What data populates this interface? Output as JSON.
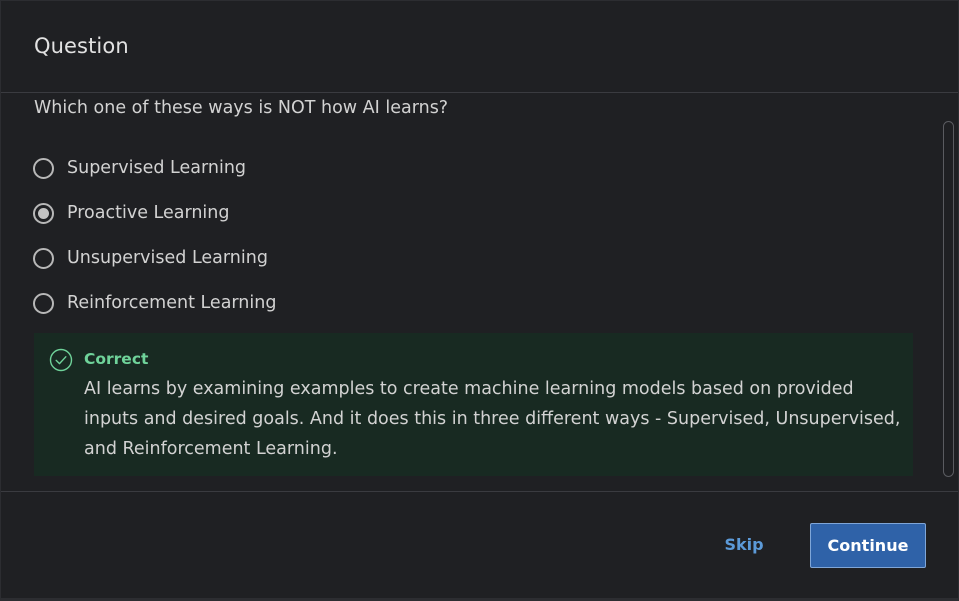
{
  "dialog": {
    "title": "Question"
  },
  "question": {
    "text": "Which one of these ways is NOT how AI learns?",
    "options": [
      {
        "label": "Supervised Learning",
        "selected": false
      },
      {
        "label": "Proactive Learning",
        "selected": true
      },
      {
        "label": "Unsupervised Learning",
        "selected": false
      },
      {
        "label": "Reinforcement Learning",
        "selected": false
      }
    ]
  },
  "feedback": {
    "status": "Correct",
    "icon": "check-circle-icon",
    "message": "AI learns by examining examples to create machine learning models based on provided inputs and desired goals. And it does this in three different ways - Supervised, Unsupervised, and Reinforcement Learning.",
    "color": "#6fd39a",
    "background": "#182a22"
  },
  "footer": {
    "skip_label": "Skip",
    "continue_label": "Continue"
  },
  "colors": {
    "accent": "#2f62a8",
    "link": "#5c9ad8",
    "background": "#1f2023"
  }
}
